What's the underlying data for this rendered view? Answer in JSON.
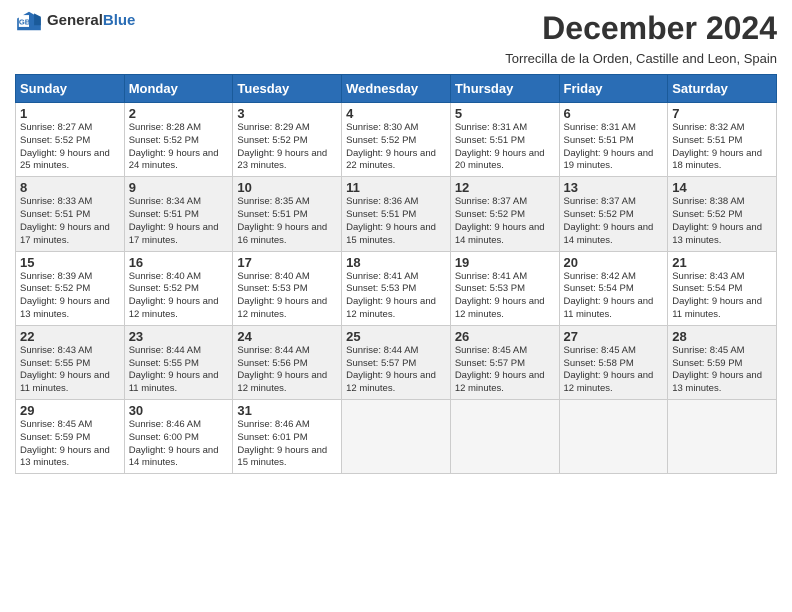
{
  "header": {
    "logo_general": "General",
    "logo_blue": "Blue",
    "month_title": "December 2024",
    "location": "Torrecilla de la Orden, Castille and Leon, Spain"
  },
  "days_of_week": [
    "Sunday",
    "Monday",
    "Tuesday",
    "Wednesday",
    "Thursday",
    "Friday",
    "Saturday"
  ],
  "weeks": [
    [
      {
        "day": 1,
        "sunrise": "8:27 AM",
        "sunset": "5:52 PM",
        "daylight": "9 hours and 25 minutes."
      },
      {
        "day": 2,
        "sunrise": "8:28 AM",
        "sunset": "5:52 PM",
        "daylight": "9 hours and 24 minutes."
      },
      {
        "day": 3,
        "sunrise": "8:29 AM",
        "sunset": "5:52 PM",
        "daylight": "9 hours and 23 minutes."
      },
      {
        "day": 4,
        "sunrise": "8:30 AM",
        "sunset": "5:52 PM",
        "daylight": "9 hours and 22 minutes."
      },
      {
        "day": 5,
        "sunrise": "8:31 AM",
        "sunset": "5:51 PM",
        "daylight": "9 hours and 20 minutes."
      },
      {
        "day": 6,
        "sunrise": "8:31 AM",
        "sunset": "5:51 PM",
        "daylight": "9 hours and 19 minutes."
      },
      {
        "day": 7,
        "sunrise": "8:32 AM",
        "sunset": "5:51 PM",
        "daylight": "9 hours and 18 minutes."
      }
    ],
    [
      {
        "day": 8,
        "sunrise": "8:33 AM",
        "sunset": "5:51 PM",
        "daylight": "9 hours and 17 minutes."
      },
      {
        "day": 9,
        "sunrise": "8:34 AM",
        "sunset": "5:51 PM",
        "daylight": "9 hours and 17 minutes."
      },
      {
        "day": 10,
        "sunrise": "8:35 AM",
        "sunset": "5:51 PM",
        "daylight": "9 hours and 16 minutes."
      },
      {
        "day": 11,
        "sunrise": "8:36 AM",
        "sunset": "5:51 PM",
        "daylight": "9 hours and 15 minutes."
      },
      {
        "day": 12,
        "sunrise": "8:37 AM",
        "sunset": "5:52 PM",
        "daylight": "9 hours and 14 minutes."
      },
      {
        "day": 13,
        "sunrise": "8:37 AM",
        "sunset": "5:52 PM",
        "daylight": "9 hours and 14 minutes."
      },
      {
        "day": 14,
        "sunrise": "8:38 AM",
        "sunset": "5:52 PM",
        "daylight": "9 hours and 13 minutes."
      }
    ],
    [
      {
        "day": 15,
        "sunrise": "8:39 AM",
        "sunset": "5:52 PM",
        "daylight": "9 hours and 13 minutes."
      },
      {
        "day": 16,
        "sunrise": "8:40 AM",
        "sunset": "5:52 PM",
        "daylight": "9 hours and 12 minutes."
      },
      {
        "day": 17,
        "sunrise": "8:40 AM",
        "sunset": "5:53 PM",
        "daylight": "9 hours and 12 minutes."
      },
      {
        "day": 18,
        "sunrise": "8:41 AM",
        "sunset": "5:53 PM",
        "daylight": "9 hours and 12 minutes."
      },
      {
        "day": 19,
        "sunrise": "8:41 AM",
        "sunset": "5:53 PM",
        "daylight": "9 hours and 12 minutes."
      },
      {
        "day": 20,
        "sunrise": "8:42 AM",
        "sunset": "5:54 PM",
        "daylight": "9 hours and 11 minutes."
      },
      {
        "day": 21,
        "sunrise": "8:43 AM",
        "sunset": "5:54 PM",
        "daylight": "9 hours and 11 minutes."
      }
    ],
    [
      {
        "day": 22,
        "sunrise": "8:43 AM",
        "sunset": "5:55 PM",
        "daylight": "9 hours and 11 minutes."
      },
      {
        "day": 23,
        "sunrise": "8:44 AM",
        "sunset": "5:55 PM",
        "daylight": "9 hours and 11 minutes."
      },
      {
        "day": 24,
        "sunrise": "8:44 AM",
        "sunset": "5:56 PM",
        "daylight": "9 hours and 12 minutes."
      },
      {
        "day": 25,
        "sunrise": "8:44 AM",
        "sunset": "5:57 PM",
        "daylight": "9 hours and 12 minutes."
      },
      {
        "day": 26,
        "sunrise": "8:45 AM",
        "sunset": "5:57 PM",
        "daylight": "9 hours and 12 minutes."
      },
      {
        "day": 27,
        "sunrise": "8:45 AM",
        "sunset": "5:58 PM",
        "daylight": "9 hours and 12 minutes."
      },
      {
        "day": 28,
        "sunrise": "8:45 AM",
        "sunset": "5:59 PM",
        "daylight": "9 hours and 13 minutes."
      }
    ],
    [
      {
        "day": 29,
        "sunrise": "8:45 AM",
        "sunset": "5:59 PM",
        "daylight": "9 hours and 13 minutes."
      },
      {
        "day": 30,
        "sunrise": "8:46 AM",
        "sunset": "6:00 PM",
        "daylight": "9 hours and 14 minutes."
      },
      {
        "day": 31,
        "sunrise": "8:46 AM",
        "sunset": "6:01 PM",
        "daylight": "9 hours and 15 minutes."
      },
      null,
      null,
      null,
      null
    ]
  ]
}
